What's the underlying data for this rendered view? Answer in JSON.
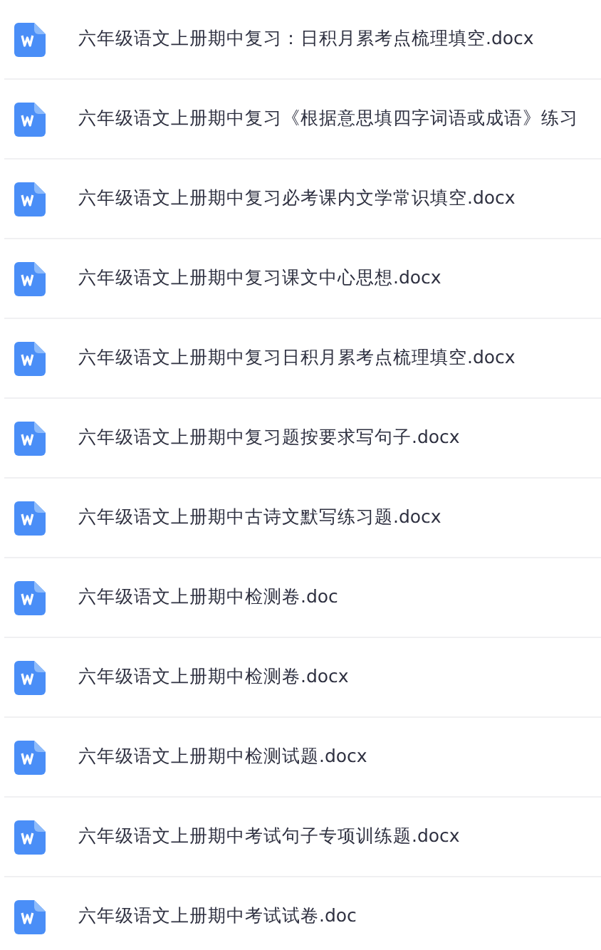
{
  "files": [
    {
      "name": "六年级语文上册期中复习：日积月累考点梳理填空.docx"
    },
    {
      "name": "六年级语文上册期中复习《根据意思填四字词语或成语》练习"
    },
    {
      "name": "六年级语文上册期中复习必考课内文学常识填空.docx"
    },
    {
      "name": "六年级语文上册期中复习课文中心思想.docx"
    },
    {
      "name": "六年级语文上册期中复习日积月累考点梳理填空.docx"
    },
    {
      "name": "六年级语文上册期中复习题按要求写句子.docx"
    },
    {
      "name": "六年级语文上册期中古诗文默写练习题.docx"
    },
    {
      "name": "六年级语文上册期中检测卷.doc"
    },
    {
      "name": "六年级语文上册期中检测卷.docx"
    },
    {
      "name": "六年级语文上册期中检测试题.docx"
    },
    {
      "name": "六年级语文上册期中考试句子专项训练题.docx"
    },
    {
      "name": "六年级语文上册期中考试试卷.doc"
    }
  ]
}
